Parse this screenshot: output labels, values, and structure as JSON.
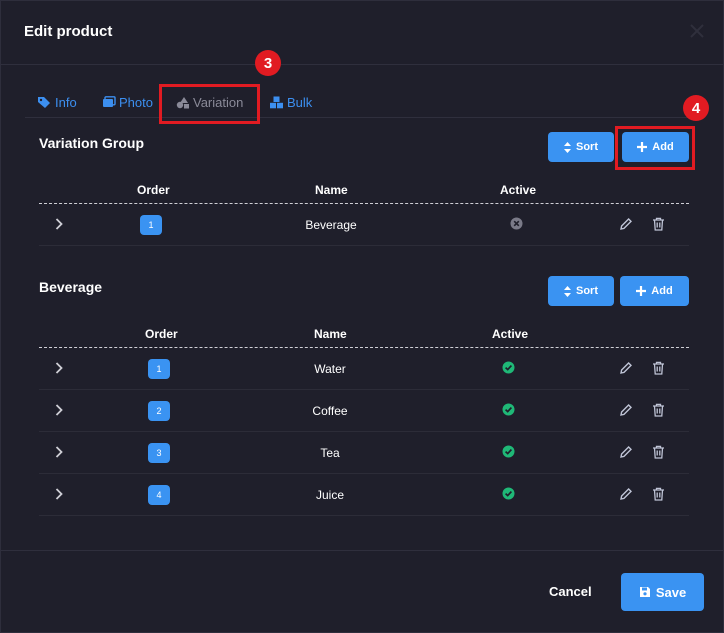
{
  "modal": {
    "title": "Edit product"
  },
  "tabs": [
    {
      "label": "Info",
      "icon": "tag-icon"
    },
    {
      "label": "Photo",
      "icon": "images-icon"
    },
    {
      "label": "Variation",
      "icon": "shapes-icon"
    },
    {
      "label": "Bulk",
      "icon": "boxes-icon"
    }
  ],
  "annotations": {
    "step3": "3",
    "step4": "4",
    "color": "#e11b22"
  },
  "variation_group": {
    "title": "Variation Group",
    "sort_label": "Sort",
    "add_label": "Add",
    "columns": {
      "order": "Order",
      "name": "Name",
      "active": "Active"
    },
    "rows": [
      {
        "order": "1",
        "name": "Beverage",
        "active": false
      }
    ]
  },
  "beverage": {
    "title": "Beverage",
    "sort_label": "Sort",
    "add_label": "Add",
    "columns": {
      "order": "Order",
      "name": "Name",
      "active": "Active"
    },
    "rows": [
      {
        "order": "1",
        "name": "Water",
        "active": true
      },
      {
        "order": "2",
        "name": "Coffee",
        "active": true
      },
      {
        "order": "3",
        "name": "Tea",
        "active": true
      },
      {
        "order": "4",
        "name": "Juice",
        "active": true
      }
    ]
  },
  "footer": {
    "cancel_label": "Cancel",
    "save_label": "Save"
  },
  "colors": {
    "accent": "#3a93f2",
    "success": "#1fb877",
    "inactive": "#7a7a88",
    "background": "#1f1f2b"
  }
}
